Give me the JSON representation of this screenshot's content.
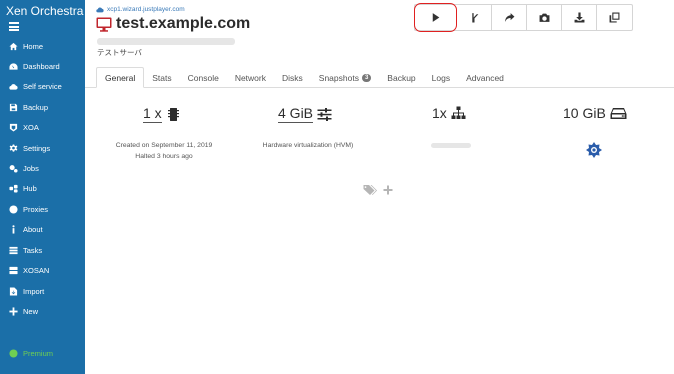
{
  "app": {
    "title": "Xen Orchestra"
  },
  "sidebar": {
    "items": [
      {
        "label": "Home",
        "icon": "home-icon"
      },
      {
        "label": "Dashboard",
        "icon": "dashboard-icon"
      },
      {
        "label": "Self service",
        "icon": "cloud-icon"
      },
      {
        "label": "Backup",
        "icon": "backup-icon"
      },
      {
        "label": "XOA",
        "icon": "xoa-icon"
      },
      {
        "label": "Settings",
        "icon": "gear-icon"
      },
      {
        "label": "Jobs",
        "icon": "jobs-icon"
      },
      {
        "label": "Hub",
        "icon": "hub-icon"
      },
      {
        "label": "Proxies",
        "icon": "proxy-icon"
      },
      {
        "label": "About",
        "icon": "info-icon"
      },
      {
        "label": "Tasks",
        "icon": "tasks-icon"
      },
      {
        "label": "XOSAN",
        "icon": "xosan-icon"
      },
      {
        "label": "Import",
        "icon": "import-icon"
      },
      {
        "label": "New",
        "icon": "plus-icon"
      }
    ],
    "premium": "Premium"
  },
  "header": {
    "host": "xcp1.wizard.justplayer.com",
    "vm_name": "test.example.com",
    "description": "テストサーバ"
  },
  "toolbar": {
    "buttons": [
      "play-icon",
      "fast-clone-icon",
      "migrate-icon",
      "snapshot-icon",
      "export-icon",
      "copy-icon"
    ]
  },
  "tabs": [
    {
      "label": "General",
      "active": true
    },
    {
      "label": "Stats"
    },
    {
      "label": "Console"
    },
    {
      "label": "Network"
    },
    {
      "label": "Disks"
    },
    {
      "label": "Snapshots",
      "badge": "3"
    },
    {
      "label": "Backup"
    },
    {
      "label": "Logs"
    },
    {
      "label": "Advanced"
    }
  ],
  "stats": {
    "cpu": "1 x",
    "memory": "4 GiB",
    "network": "1x",
    "disk": "10 GiB",
    "created": "Created on September 11, 2019",
    "status": "Halted 3 hours ago",
    "virtualization": "Hardware virtualization (HVM)"
  },
  "colors": {
    "sidebar": "#1b6fa8",
    "premium": "#6fcf52",
    "highlight": "#e02020",
    "vm_icon": "#c0262d"
  }
}
